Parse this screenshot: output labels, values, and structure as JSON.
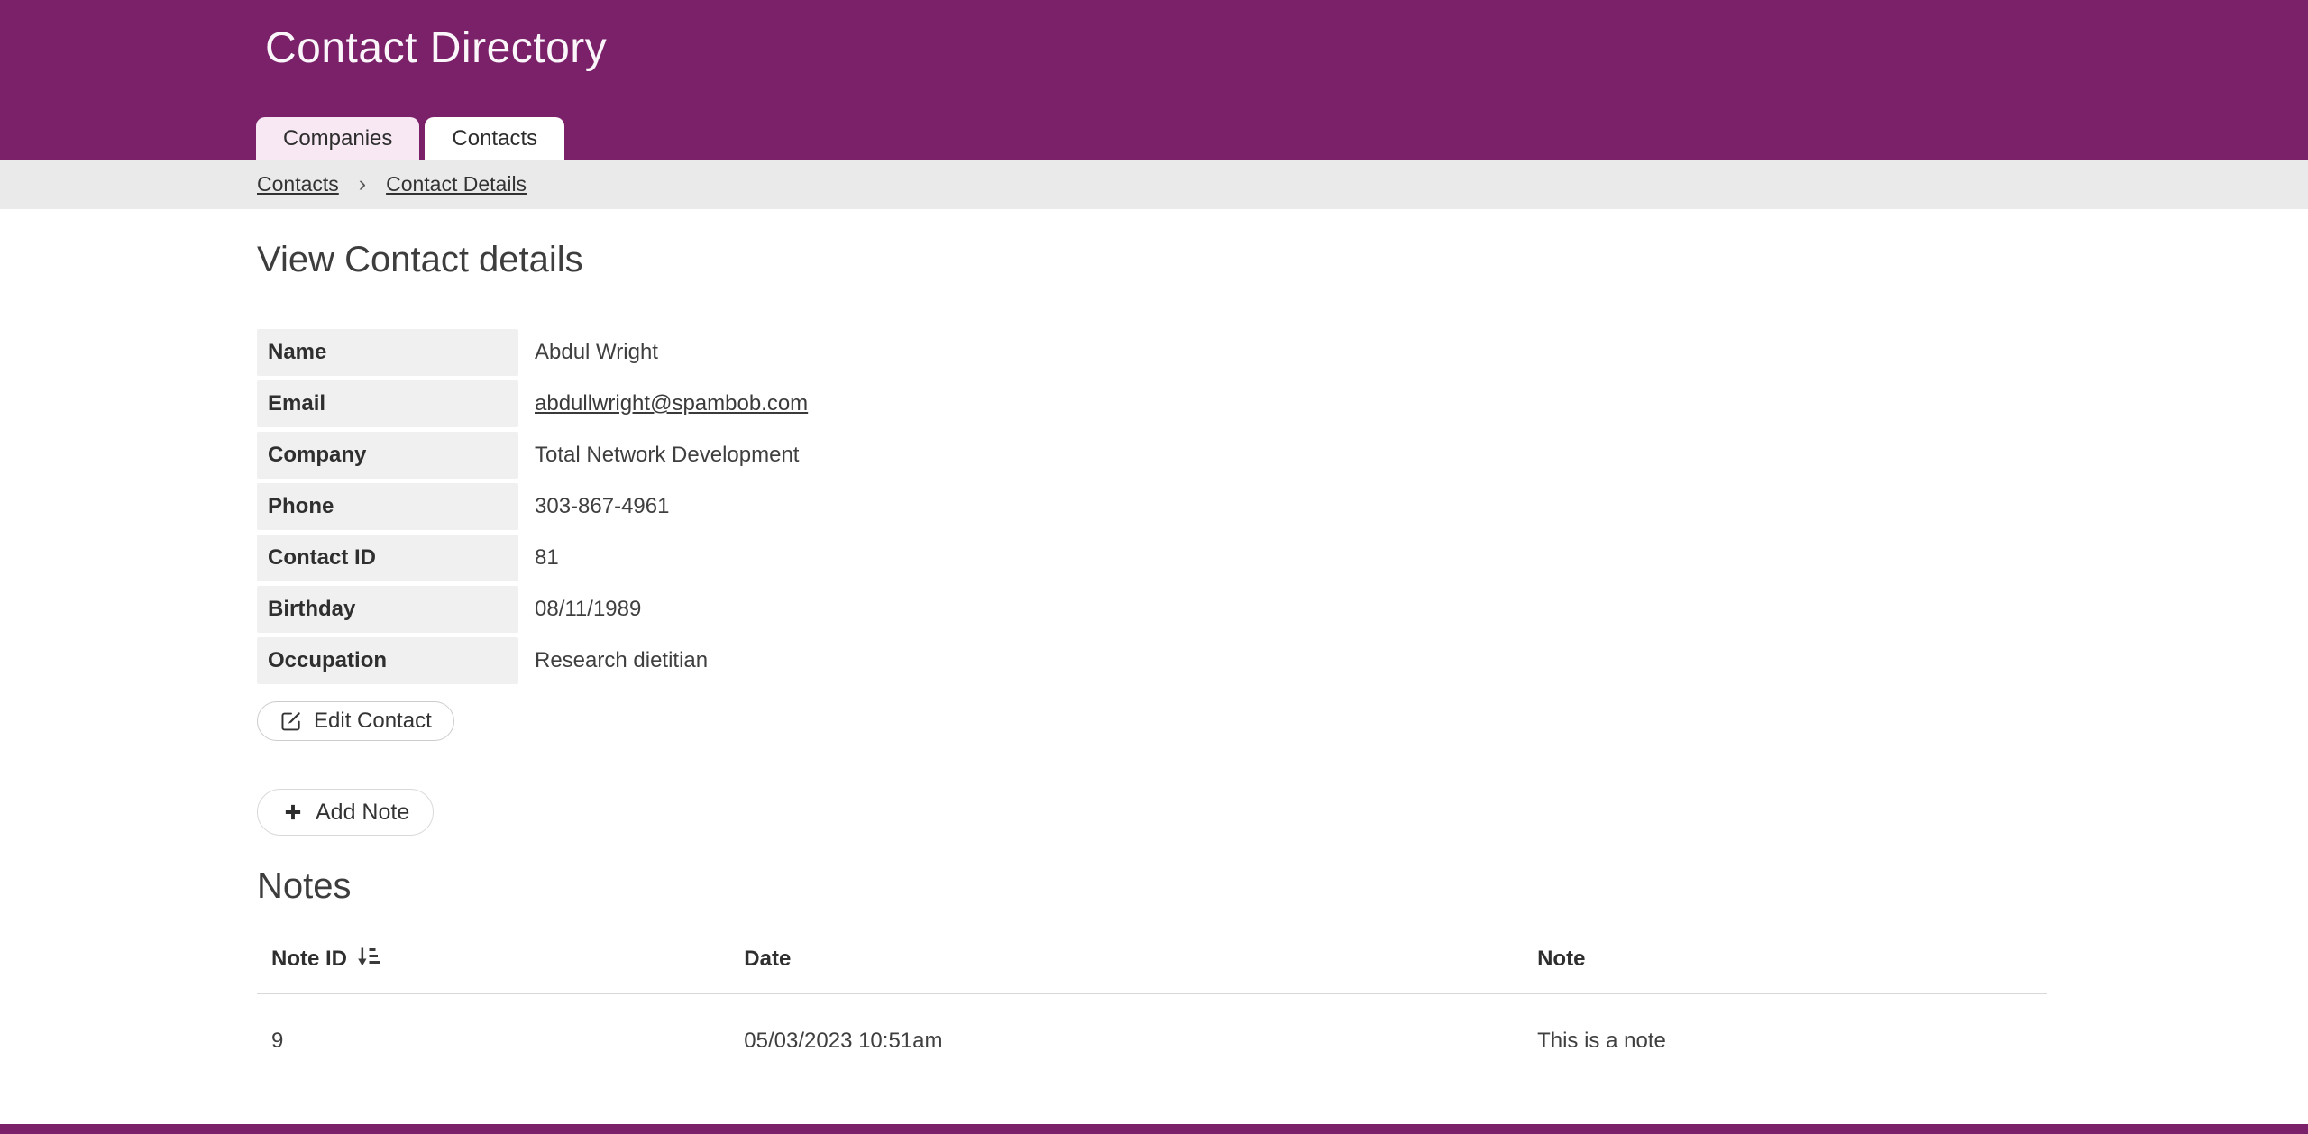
{
  "header": {
    "title": "Contact Directory"
  },
  "tabs": [
    {
      "label": "Companies"
    },
    {
      "label": "Contacts"
    }
  ],
  "breadcrumb": {
    "separator": "›",
    "items": [
      {
        "label": "Contacts"
      },
      {
        "label": "Contact Details"
      }
    ]
  },
  "page": {
    "heading": "View Contact details"
  },
  "details": {
    "rows": [
      {
        "label": "Name",
        "value": "Abdul Wright"
      },
      {
        "label": "Email",
        "value": "abdullwright@spambob.com"
      },
      {
        "label": "Company",
        "value": "Total Network Development"
      },
      {
        "label": "Phone",
        "value": "303-867-4961"
      },
      {
        "label": "Contact ID",
        "value": "81"
      },
      {
        "label": "Birthday",
        "value": "08/11/1989"
      },
      {
        "label": "Occupation",
        "value": "Research dietitian"
      }
    ]
  },
  "buttons": {
    "edit": "Edit Contact",
    "add_note": "Add Note",
    "edit_icon": "edit-pencil-square-icon",
    "add_icon": "plus-icon"
  },
  "notes": {
    "heading": "Notes",
    "columns": [
      {
        "label": "Note ID",
        "sort_icon": "sort-amount-down-icon"
      },
      {
        "label": "Date"
      },
      {
        "label": "Note"
      }
    ],
    "rows": [
      {
        "note_id": "9",
        "date": "05/03/2023 10:51am",
        "note": "This is a note"
      }
    ]
  },
  "colors": {
    "header_purple": "#7a2169",
    "tab_highlight_pink": "#f7e8f3",
    "breadcrumb_bg": "#eaeaea",
    "detail_label_bg": "#f0f0f0"
  }
}
